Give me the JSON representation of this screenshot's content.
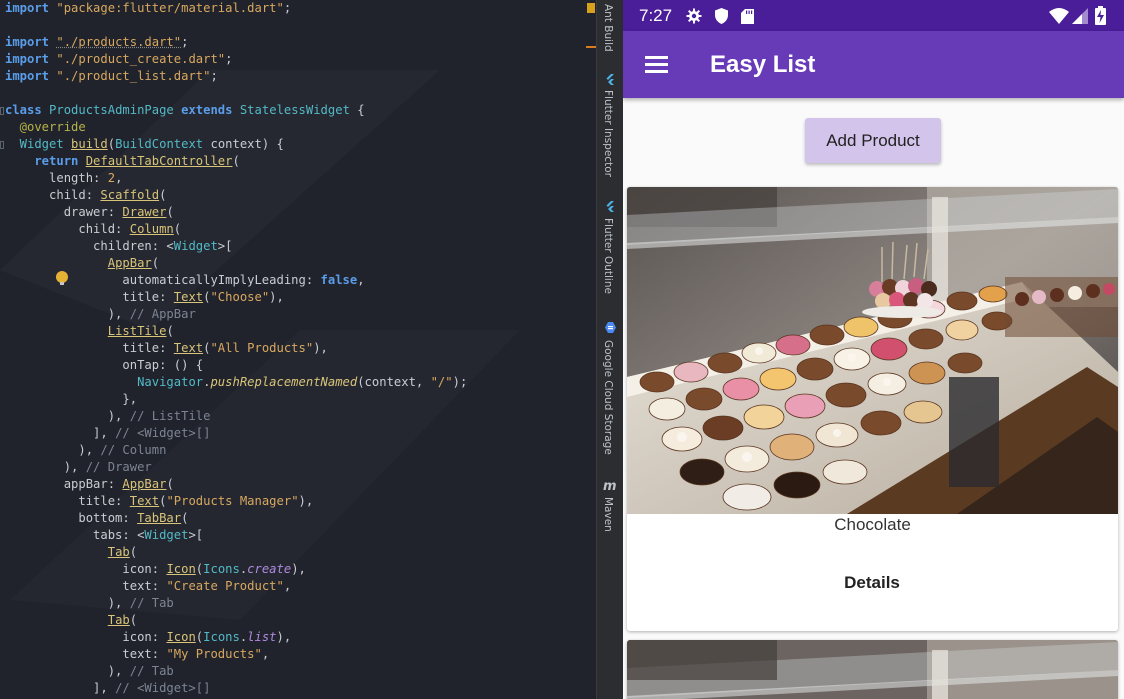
{
  "colors": {
    "editor_bg": "#20232b",
    "app_primary": "#673ab7",
    "status_bar": "#4a1d99",
    "button_bg": "#d3c4ec"
  },
  "editor": {
    "lines": [
      [
        [
          "kw",
          "import"
        ],
        [
          "p",
          " "
        ],
        [
          "str",
          "\"package:flutter/material.dart\""
        ],
        [
          "p",
          ";"
        ]
      ],
      [],
      [
        [
          "kw",
          "import"
        ],
        [
          "p",
          " "
        ],
        [
          "str dul",
          "\"./products.dart\""
        ],
        [
          "p",
          ";"
        ]
      ],
      [
        [
          "kw",
          "import"
        ],
        [
          "p",
          " "
        ],
        [
          "str",
          "\"./product_create.dart\""
        ],
        [
          "p",
          ";"
        ]
      ],
      [
        [
          "kw",
          "import"
        ],
        [
          "p",
          " "
        ],
        [
          "str",
          "\"./product_list.dart\""
        ],
        [
          "p",
          ";"
        ]
      ],
      [],
      [
        [
          "kw",
          "class"
        ],
        [
          "p",
          " "
        ],
        [
          "cls",
          "ProductsAdminPage"
        ],
        [
          "p",
          " "
        ],
        [
          "kw",
          "extends"
        ],
        [
          "p",
          " "
        ],
        [
          "cls",
          "StatelessWidget"
        ],
        [
          "p",
          " {"
        ]
      ],
      [
        [
          "an",
          "  @override"
        ]
      ],
      [
        [
          "cls",
          "  Widget"
        ],
        [
          "p",
          " "
        ],
        [
          "fn ul",
          "build"
        ],
        [
          "p",
          "("
        ],
        [
          "cls",
          "BuildContext"
        ],
        [
          "p",
          " context) {"
        ]
      ],
      [
        [
          "kw",
          "    return"
        ],
        [
          "p",
          " "
        ],
        [
          "fn ul",
          "DefaultTabController"
        ],
        [
          "p",
          "("
        ]
      ],
      [
        [
          "p",
          "      length: "
        ],
        [
          "str",
          "2"
        ],
        [
          "p",
          ","
        ]
      ],
      [
        [
          "p",
          "      child: "
        ],
        [
          "fn ul",
          "Scaffold"
        ],
        [
          "p",
          "("
        ]
      ],
      [
        [
          "p",
          "        drawer: "
        ],
        [
          "fn ul",
          "Drawer"
        ],
        [
          "p",
          "("
        ]
      ],
      [
        [
          "p",
          "          child: "
        ],
        [
          "fn ul",
          "Column"
        ],
        [
          "p",
          "("
        ]
      ],
      [
        [
          "p",
          "            children: <"
        ],
        [
          "cls",
          "Widget"
        ],
        [
          "p",
          ">["
        ]
      ],
      [
        [
          "p",
          "              "
        ],
        [
          "fn ul",
          "AppBar"
        ],
        [
          "p",
          "("
        ]
      ],
      [
        [
          "p",
          "                automaticallyImplyLeading: "
        ],
        [
          "kw",
          "false"
        ],
        [
          "p",
          ","
        ]
      ],
      [
        [
          "p",
          "                title: "
        ],
        [
          "fn ul",
          "Text"
        ],
        [
          "p",
          "("
        ],
        [
          "str",
          "\"Choose\""
        ],
        [
          "p",
          "),"
        ]
      ],
      [
        [
          "p",
          "              ), "
        ],
        [
          "cmt",
          "// AppBar"
        ]
      ],
      [
        [
          "p",
          "              "
        ],
        [
          "fn ul",
          "ListTile"
        ],
        [
          "p",
          "("
        ]
      ],
      [
        [
          "p",
          "                title: "
        ],
        [
          "fn ul",
          "Text"
        ],
        [
          "p",
          "("
        ],
        [
          "str",
          "\"All Products\""
        ],
        [
          "p",
          "),"
        ]
      ],
      [
        [
          "p",
          "                onTap: () {"
        ]
      ],
      [
        [
          "p",
          "                  "
        ],
        [
          "cls",
          "Navigator"
        ],
        [
          "p",
          "."
        ],
        [
          "meth",
          "pushReplacementNamed"
        ],
        [
          "p",
          "(context, "
        ],
        [
          "str",
          "\"/\""
        ],
        [
          "p",
          ");"
        ]
      ],
      [
        [
          "p",
          "                },"
        ]
      ],
      [
        [
          "p",
          "              ), "
        ],
        [
          "cmt",
          "// ListTile"
        ]
      ],
      [
        [
          "p",
          "            ], "
        ],
        [
          "cmt",
          "// <Widget>[]"
        ]
      ],
      [
        [
          "p",
          "          ), "
        ],
        [
          "cmt",
          "// Column"
        ]
      ],
      [
        [
          "p",
          "        ), "
        ],
        [
          "cmt",
          "// Drawer"
        ]
      ],
      [
        [
          "p",
          "        appBar: "
        ],
        [
          "fn ul",
          "AppBar"
        ],
        [
          "p",
          "("
        ]
      ],
      [
        [
          "p",
          "          title: "
        ],
        [
          "fn ul",
          "Text"
        ],
        [
          "p",
          "("
        ],
        [
          "str",
          "\"Products Manager\""
        ],
        [
          "p",
          "),"
        ]
      ],
      [
        [
          "p",
          "          bottom: "
        ],
        [
          "fn ul",
          "TabBar"
        ],
        [
          "p",
          "("
        ]
      ],
      [
        [
          "p",
          "            tabs: <"
        ],
        [
          "cls",
          "Widget"
        ],
        [
          "p",
          ">["
        ]
      ],
      [
        [
          "p",
          "              "
        ],
        [
          "fn ul",
          "Tab"
        ],
        [
          "p",
          "("
        ]
      ],
      [
        [
          "p",
          "                icon: "
        ],
        [
          "fn ul",
          "Icon"
        ],
        [
          "p",
          "("
        ],
        [
          "cls",
          "Icons"
        ],
        [
          "p",
          "."
        ],
        [
          "prm",
          "create"
        ],
        [
          "p",
          "),"
        ]
      ],
      [
        [
          "p",
          "                text: "
        ],
        [
          "str",
          "\"Create Product\""
        ],
        [
          "p",
          ","
        ]
      ],
      [
        [
          "p",
          "              ), "
        ],
        [
          "cmt",
          "// Tab"
        ]
      ],
      [
        [
          "p",
          "              "
        ],
        [
          "fn ul",
          "Tab"
        ],
        [
          "p",
          "("
        ]
      ],
      [
        [
          "p",
          "                icon: "
        ],
        [
          "fn ul",
          "Icon"
        ],
        [
          "p",
          "("
        ],
        [
          "cls",
          "Icons"
        ],
        [
          "p",
          "."
        ],
        [
          "prm",
          "list"
        ],
        [
          "p",
          "),"
        ]
      ],
      [
        [
          "p",
          "                text: "
        ],
        [
          "str",
          "\"My Products\""
        ],
        [
          "p",
          ","
        ]
      ],
      [
        [
          "p",
          "              ), "
        ],
        [
          "cmt",
          "// Tab"
        ]
      ],
      [
        [
          "p",
          "            ], "
        ],
        [
          "cmt",
          "// <Widget>[]"
        ]
      ]
    ],
    "highlighted_line": 16
  },
  "tool_strip": {
    "ant_build": "Ant Build",
    "flutter_inspector": "Flutter Inspector",
    "flutter_outline": "Flutter Outline",
    "gcs": "Google Cloud Storage",
    "maven_icon": "m",
    "maven": "Maven"
  },
  "phone": {
    "status": {
      "time": "7:27",
      "icons": [
        "gear-icon",
        "shield-icon",
        "sd-card-icon",
        "wifi-icon",
        "signal-icon",
        "battery-icon"
      ]
    },
    "appbar": {
      "title": "Easy List",
      "menu_icon": "menu-icon"
    },
    "add_product_label": "Add Product",
    "products": [
      {
        "title": "Chocolate",
        "details_label": "Details"
      }
    ]
  }
}
